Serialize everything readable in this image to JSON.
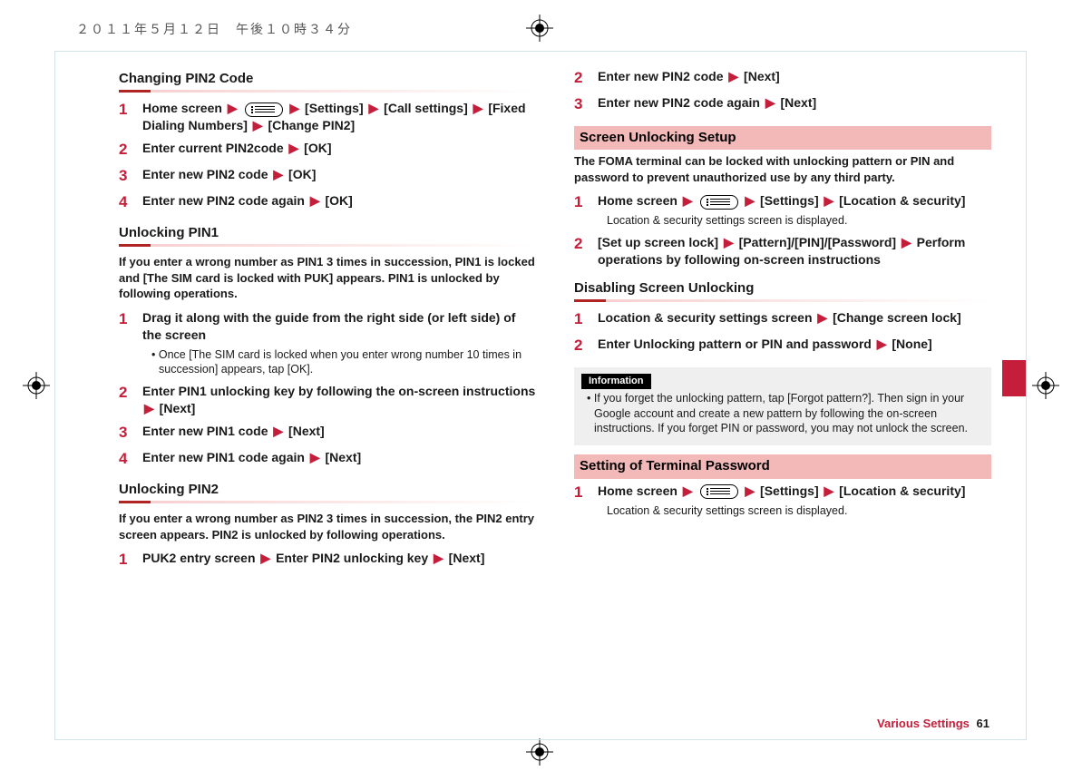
{
  "meta": {
    "timestamp": "２０１１年５月１２日　午後１０時３４分"
  },
  "left": {
    "h1": "Changing PIN2 Code",
    "s1": [
      "Home screen ▶ [MENU] ▶ [Settings] ▶ [Call settings] ▶ [Fixed Dialing Numbers] ▶ [Change PIN2]",
      "Enter current PIN2code ▶ [OK]",
      "Enter new PIN2 code ▶ [OK]",
      "Enter new PIN2 code again ▶ [OK]"
    ],
    "h2": "Unlocking PIN1",
    "intro2": "If you enter a wrong number as PIN1 3 times in succession, PIN1 is locked and [The SIM card is locked with PUK] appears. PIN1 is unlocked by following operations.",
    "s2_1": "Drag it along with the guide from the right side (or left side) of the screen",
    "s2_1_sub": "• Once [The SIM card is locked when you enter wrong number 10 times in succession] appears, tap [OK].",
    "s2_2": "Enter PIN1 unlocking key by following the on-screen instructions ▶ [Next]",
    "s2_3": "Enter new PIN1 code ▶ [Next]",
    "s2_4": "Enter new PIN1 code again ▶ [Next]",
    "h3": "Unlocking PIN2",
    "intro3": "If you enter a wrong number as PIN2 3 times in succession, the PIN2 entry screen appears. PIN2 is unlocked by following operations.",
    "s3_1": "PUK2 entry screen ▶ Enter PIN2 unlocking key ▶ [Next]"
  },
  "right": {
    "cont2": "Enter new PIN2 code ▶ [Next]",
    "cont3": "Enter new PIN2 code again ▶ [Next]",
    "pink1": "Screen Unlocking Setup",
    "intro1": "The FOMA terminal can be locked with unlocking pattern or PIN and password to prevent unauthorized use by any third party.",
    "s1_1": "Home screen ▶ [MENU] ▶ [Settings] ▶ [Location & security]",
    "s1_1_sub": "Location & security settings screen is displayed.",
    "s1_2": "[Set up screen lock] ▶ [Pattern]/[PIN]/[Password] ▶ Perform operations by following on-screen instructions",
    "h2": "Disabling Screen Unlocking",
    "s2_1": "Location & security settings screen ▶ [Change screen lock]",
    "s2_2": "Enter Unlocking pattern or PIN and password ▶ [None]",
    "info_label": "Information",
    "info_body": "• If you forget the unlocking pattern, tap [Forgot pattern?]. Then sign in your Google account and create a new pattern by following the on-screen instructions. If you forget PIN or password, you may not unlock the screen.",
    "pink2": "Setting of Terminal Password",
    "s3_1": "Home screen ▶ [MENU] ▶ [Settings] ▶ [Location & security]",
    "s3_1_sub": "Location & security settings screen is displayed."
  },
  "footer": {
    "section": "Various Settings",
    "page": "61"
  }
}
